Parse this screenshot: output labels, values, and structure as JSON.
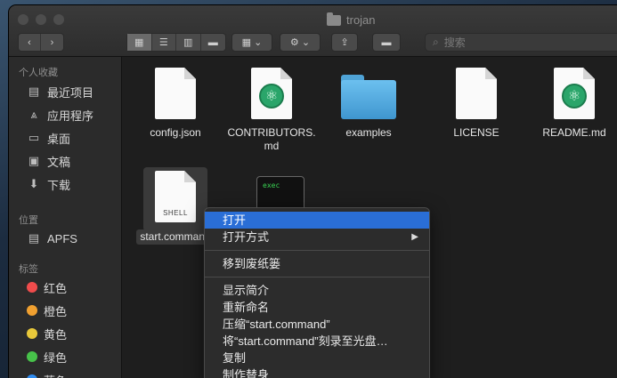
{
  "window": {
    "title": "trojan"
  },
  "toolbar": {
    "search_placeholder": "搜索"
  },
  "sidebar": {
    "favorites_heading": "个人收藏",
    "favorites": [
      {
        "label": "最近项目",
        "icon": "recents-icon"
      },
      {
        "label": "应用程序",
        "icon": "applications-icon"
      },
      {
        "label": "桌面",
        "icon": "desktop-icon"
      },
      {
        "label": "文稿",
        "icon": "documents-icon"
      },
      {
        "label": "下载",
        "icon": "downloads-icon"
      }
    ],
    "locations_heading": "位置",
    "locations": [
      {
        "label": "APFS",
        "icon": "disk-icon"
      }
    ],
    "tags_heading": "标签",
    "tags": [
      {
        "label": "红色",
        "color": "#f04c4c"
      },
      {
        "label": "橙色",
        "color": "#f0a030"
      },
      {
        "label": "黄色",
        "color": "#e8c83a"
      },
      {
        "label": "绿色",
        "color": "#47c24a"
      },
      {
        "label": "蓝色",
        "color": "#2f8cf0"
      }
    ]
  },
  "files": [
    {
      "name": "config.json",
      "kind": "document"
    },
    {
      "name": "CONTRIBUTORS.md",
      "name_line1": "CONTRIBUTORS.",
      "name_line2": "md",
      "kind": "atom-document"
    },
    {
      "name": "examples",
      "kind": "folder"
    },
    {
      "name": "LICENSE",
      "kind": "document"
    },
    {
      "name": "README.md",
      "kind": "atom-document"
    },
    {
      "name": "start.command",
      "kind": "shell-document",
      "icon_label": "SHELL",
      "selected": true
    },
    {
      "name": "",
      "kind": "exec",
      "icon_label": "exec"
    }
  ],
  "context_menu": {
    "items": [
      {
        "label": "打开",
        "highlighted": true
      },
      {
        "label": "打开方式",
        "submenu": true
      },
      {
        "separator": true
      },
      {
        "label": "移到废纸篓"
      },
      {
        "separator": true
      },
      {
        "label": "显示简介"
      },
      {
        "label": "重新命名"
      },
      {
        "label": "压缩“start.command”"
      },
      {
        "label": "将“start.command”刻录至光盘…"
      },
      {
        "label": "复制"
      },
      {
        "label": "制作替身"
      }
    ]
  },
  "colors": {
    "highlight": "#2a6ed6",
    "folder": "#4fa3d6",
    "atom": "#2aa56a"
  }
}
